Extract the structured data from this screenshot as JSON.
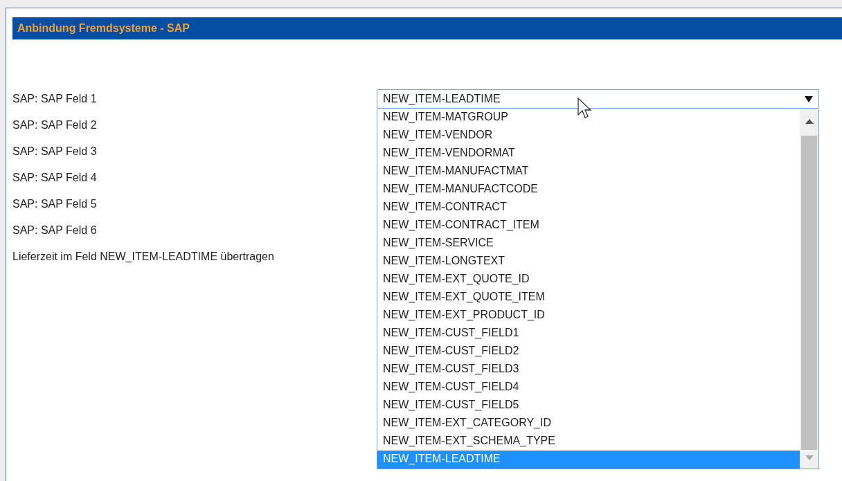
{
  "panel": {
    "title": "Anbindung Fremdsysteme - SAP"
  },
  "fields": [
    {
      "label": "SAP: SAP Feld 1",
      "value": "NEW_ITEM-LEADTIME",
      "expanded": true
    },
    {
      "label": "SAP: SAP Feld 2"
    },
    {
      "label": "SAP: SAP Feld 3"
    },
    {
      "label": "SAP: SAP Feld 4"
    },
    {
      "label": "SAP: SAP Feld 5"
    },
    {
      "label": "SAP: SAP Feld 6"
    },
    {
      "label": "Lieferzeit im Feld NEW_ITEM-LEADTIME übertragen"
    }
  ],
  "dropdown_options": [
    {
      "label": "NEW_ITEM-MATGROUP",
      "selected": false
    },
    {
      "label": "NEW_ITEM-VENDOR",
      "selected": false
    },
    {
      "label": "NEW_ITEM-VENDORMAT",
      "selected": false
    },
    {
      "label": "NEW_ITEM-MANUFACTMAT",
      "selected": false
    },
    {
      "label": "NEW_ITEM-MANUFACTCODE",
      "selected": false
    },
    {
      "label": "NEW_ITEM-CONTRACT",
      "selected": false
    },
    {
      "label": "NEW_ITEM-CONTRACT_ITEM",
      "selected": false
    },
    {
      "label": "NEW_ITEM-SERVICE",
      "selected": false
    },
    {
      "label": "NEW_ITEM-LONGTEXT",
      "selected": false
    },
    {
      "label": "NEW_ITEM-EXT_QUOTE_ID",
      "selected": false
    },
    {
      "label": "NEW_ITEM-EXT_QUOTE_ITEM",
      "selected": false
    },
    {
      "label": "NEW_ITEM-EXT_PRODUCT_ID",
      "selected": false
    },
    {
      "label": "NEW_ITEM-CUST_FIELD1",
      "selected": false
    },
    {
      "label": "NEW_ITEM-CUST_FIELD2",
      "selected": false
    },
    {
      "label": "NEW_ITEM-CUST_FIELD3",
      "selected": false
    },
    {
      "label": "NEW_ITEM-CUST_FIELD4",
      "selected": false
    },
    {
      "label": "NEW_ITEM-CUST_FIELD5",
      "selected": false
    },
    {
      "label": "NEW_ITEM-EXT_CATEGORY_ID",
      "selected": false
    },
    {
      "label": "NEW_ITEM-EXT_SCHEMA_TYPE",
      "selected": false
    },
    {
      "label": "NEW_ITEM-LEADTIME",
      "selected": true
    }
  ]
}
